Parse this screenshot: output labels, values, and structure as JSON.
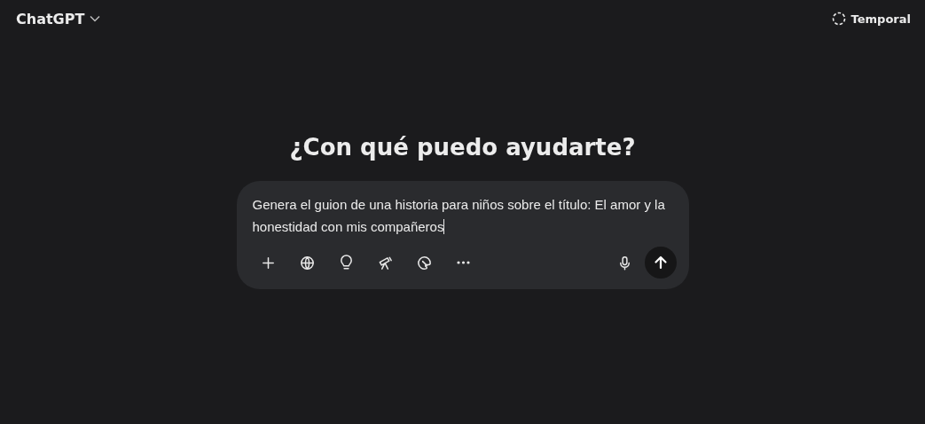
{
  "header": {
    "model": "ChatGPT",
    "temporary": "Temporal"
  },
  "heading": "¿Con qué puedo ayudarte?",
  "composer": {
    "value": "Genera el guion de una historia para niños sobre el título: El amor y la honestidad con mis compañeros",
    "tools": [
      {
        "kind": "plus"
      },
      {
        "kind": "globe"
      },
      {
        "kind": "bulb"
      },
      {
        "kind": "telescope"
      },
      {
        "kind": "palette"
      },
      {
        "kind": "more"
      }
    ]
  }
}
